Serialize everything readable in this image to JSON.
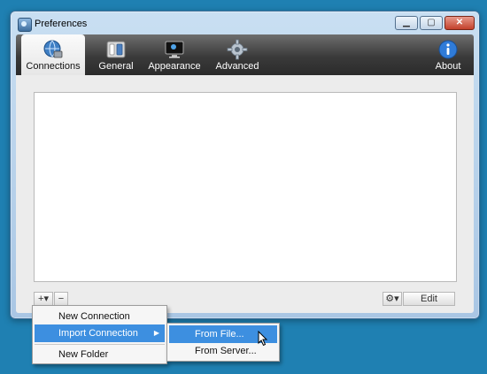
{
  "window": {
    "title": "Preferences",
    "controls": {
      "minimize": "▁",
      "maximize": "▢",
      "close": "✕"
    }
  },
  "toolbar": {
    "items": [
      {
        "label": "Connections",
        "icon": "globe-network-icon",
        "active": true
      },
      {
        "label": "General",
        "icon": "switch-panel-icon",
        "active": false
      },
      {
        "label": "Appearance",
        "icon": "monitor-icon",
        "active": false
      },
      {
        "label": "Advanced",
        "icon": "gear-icon",
        "active": false
      },
      {
        "label": "About",
        "icon": "info-icon",
        "active": false
      }
    ]
  },
  "bottom_bar": {
    "add_label": "+▾",
    "remove_label": "−",
    "action_label": "⚙▾",
    "edit_label": "Edit"
  },
  "context_menu": {
    "items": [
      {
        "label": "New Connection"
      },
      {
        "label": "Import Connection",
        "submenu_arrow": "▶",
        "highlighted": true
      },
      {
        "label": "New Folder"
      }
    ]
  },
  "submenu": {
    "items": [
      {
        "label": "From File...",
        "highlighted": true
      },
      {
        "label": "From Server..."
      }
    ]
  },
  "colors": {
    "desktop": "#1f80b2",
    "highlight": "#3d8fe0",
    "toolbar_dark": "#2b2b2b"
  }
}
